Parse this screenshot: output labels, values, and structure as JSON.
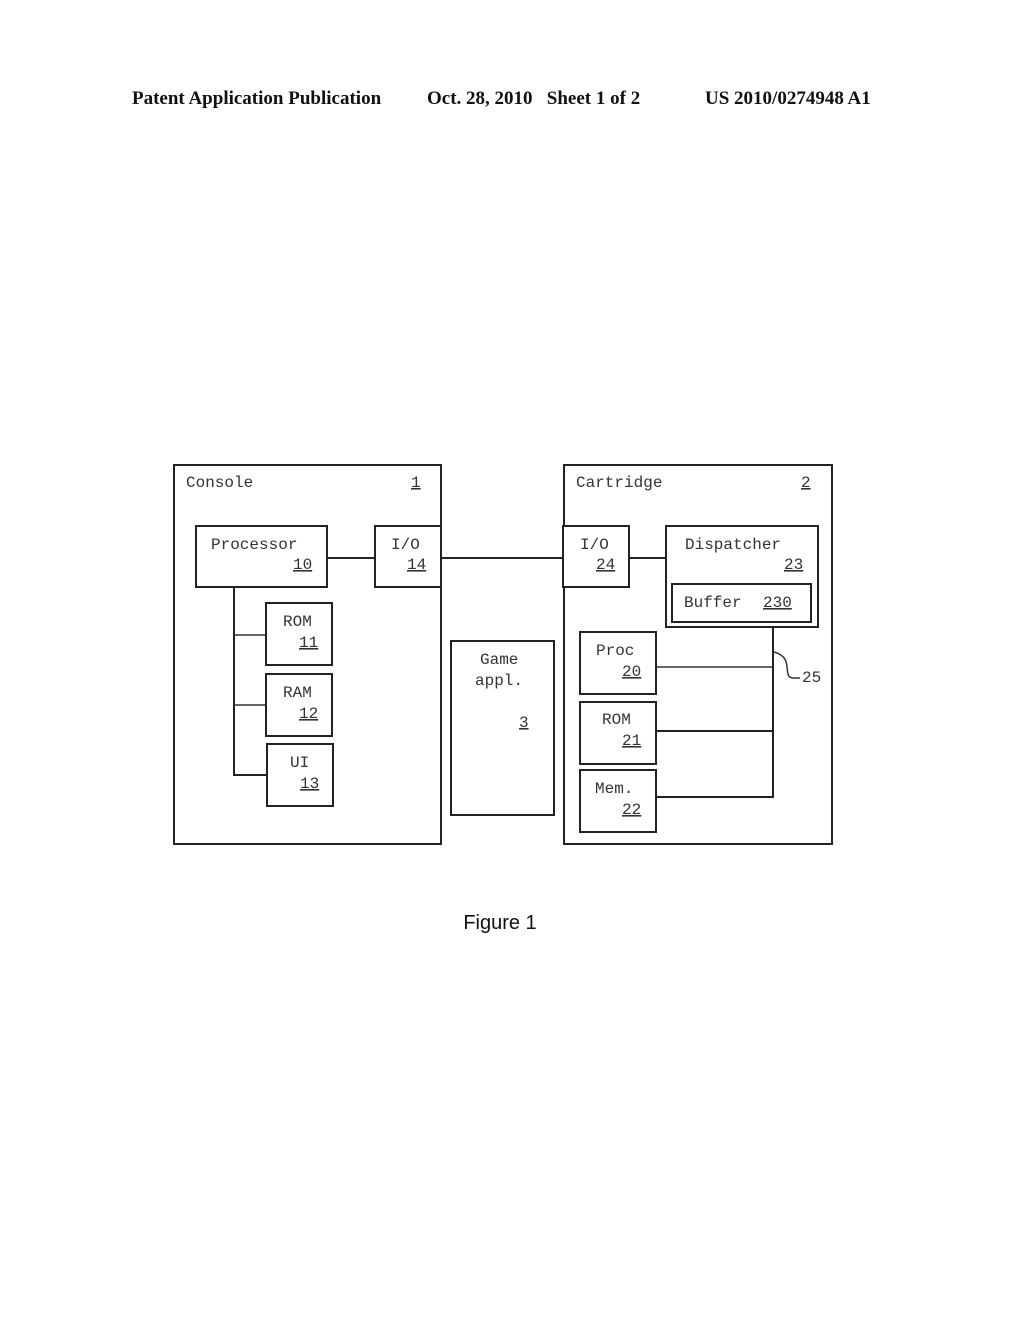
{
  "header": {
    "publication": "Patent Application Publication",
    "date_sheet": "Oct. 28, 2010   Sheet 1 of 2",
    "number": "US 2010/0274948 A1"
  },
  "diagram": {
    "console": {
      "label": "Console",
      "ref": "1"
    },
    "processor": {
      "label": "Processor",
      "ref": "10"
    },
    "console_rom": {
      "label": "ROM",
      "ref": "11"
    },
    "console_ram": {
      "label": "RAM",
      "ref": "12"
    },
    "console_ui": {
      "label": "UI",
      "ref": "13"
    },
    "console_io": {
      "label": "I/O",
      "ref": "14"
    },
    "game_app": {
      "label_line1": "Game",
      "label_line2": "appl.",
      "ref": "3"
    },
    "cartridge": {
      "label": "Cartridge",
      "ref": "2"
    },
    "cartridge_io": {
      "label": "I/O",
      "ref": "24"
    },
    "dispatcher": {
      "label": "Dispatcher",
      "ref": "23"
    },
    "buffer": {
      "label": "Buffer",
      "ref": "230"
    },
    "cart_proc": {
      "label": "Proc",
      "ref": "20"
    },
    "cart_rom": {
      "label": "ROM",
      "ref": "21"
    },
    "cart_mem": {
      "label": "Mem.",
      "ref": "22"
    },
    "bus": {
      "ref": "25"
    }
  },
  "caption": "Figure 1"
}
